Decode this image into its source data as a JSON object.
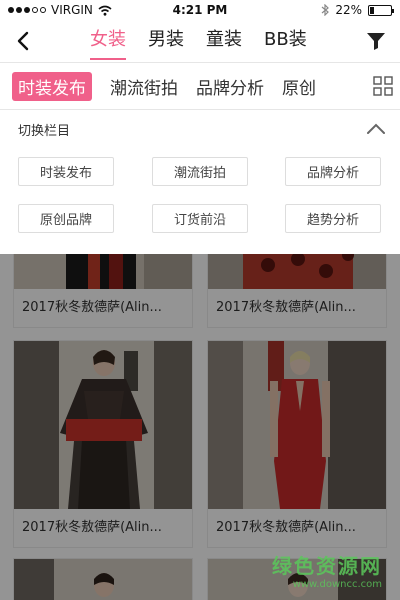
{
  "status_bar": {
    "carrier": "VIRGIN",
    "time": "4:21 PM",
    "battery": "22%",
    "battery_level": 0.22,
    "icons": [
      "signal-dots-icon",
      "wifi-icon",
      "bluetooth-icon",
      "battery-icon"
    ]
  },
  "nav": {
    "tabs": [
      {
        "label": "女装",
        "active": true
      },
      {
        "label": "男装",
        "active": false
      },
      {
        "label": "童装",
        "active": false
      },
      {
        "label": "BB装",
        "active": false
      }
    ],
    "accent": "#f0608a"
  },
  "categories": {
    "items": [
      {
        "label": "时装发布",
        "active": true
      },
      {
        "label": "潮流街拍",
        "active": false
      },
      {
        "label": "品牌分析",
        "active": false
      },
      {
        "label": "原创",
        "active": false
      }
    ]
  },
  "panel": {
    "title": "切换栏目",
    "chips": [
      "时装发布",
      "潮流街拍",
      "品牌分析",
      "原创品牌",
      "订货前沿",
      "趋势分析"
    ]
  },
  "cards": [
    {
      "caption": "2017秋冬敖德萨(Alin..."
    },
    {
      "caption": "2017秋冬敖德萨(Alin..."
    },
    {
      "caption": "2017秋冬敖德萨(Alin..."
    },
    {
      "caption": "2017秋冬敖德萨(Alin..."
    }
  ],
  "watermark": {
    "main": "绿色资源网",
    "url": "www.downcc.com"
  }
}
